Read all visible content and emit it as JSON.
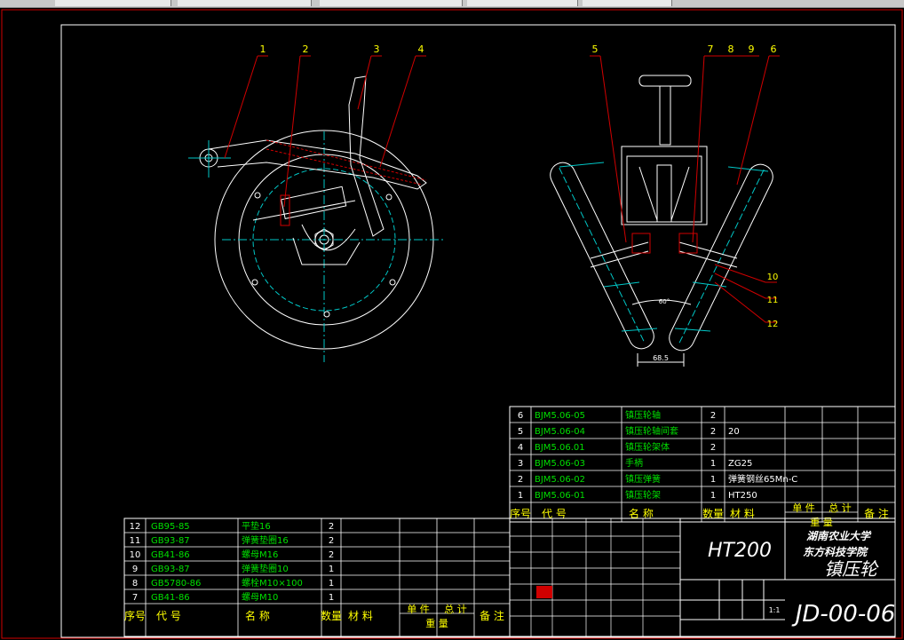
{
  "balloons_left": [
    "1",
    "2",
    "3",
    "4"
  ],
  "balloons_right": [
    "5",
    "7",
    "8",
    "9",
    "6"
  ],
  "side_balloons": [
    "10",
    "11",
    "12"
  ],
  "dims": {
    "spacing": "68.5",
    "angle": "60°"
  },
  "upper_rows": [
    {
      "no": "6",
      "code": "BJM5.06-05",
      "name": "镇压轮轴",
      "qty": "2",
      "mat": ""
    },
    {
      "no": "5",
      "code": "BJM5.06-04",
      "name": "镇压轮轴间套",
      "qty": "2",
      "mat": "20"
    },
    {
      "no": "4",
      "code": "BJM5.06.01",
      "name": "镇压轮架体",
      "qty": "2",
      "mat": ""
    },
    {
      "no": "3",
      "code": "BJM5.06-03",
      "name": "手柄",
      "qty": "1",
      "mat": "ZG25"
    },
    {
      "no": "2",
      "code": "BJM5.06-02",
      "name": "镇压弹簧",
      "qty": "1",
      "mat": "弹簧钢丝65Mn-C"
    },
    {
      "no": "1",
      "code": "BJM5.06-01",
      "name": "镇压轮架",
      "qty": "1",
      "mat": "HT250"
    }
  ],
  "lower_rows": [
    {
      "no": "12",
      "code": "GB95-85",
      "name": "平垫16",
      "qty": "2"
    },
    {
      "no": "11",
      "code": "GB93-87",
      "name": "弹簧垫圈16",
      "qty": "2"
    },
    {
      "no": "10",
      "code": "GB41-86",
      "name": "螺母M16",
      "qty": "2"
    },
    {
      "no": "9",
      "code": "GB93-87",
      "name": "弹簧垫圈10",
      "qty": "1"
    },
    {
      "no": "8",
      "code": "GB5780-86",
      "name": "螺栓M10×100",
      "qty": "1"
    },
    {
      "no": "7",
      "code": "GB41-86",
      "name": "螺母M10",
      "qty": "1"
    }
  ],
  "header": {
    "seq": "序号",
    "code": "代        号",
    "name": "名      称",
    "qty": "数量",
    "mat": "材   料",
    "single": "单 件",
    "total": "总 计",
    "weight": "重    量",
    "note": "备 注"
  },
  "title_block": {
    "material": "HT200",
    "school_1": "湖南农业大学",
    "school_2": "东方科技学院",
    "part_name": "镇压轮",
    "drawing_no": "JD-00-06",
    "scale": "1:1"
  }
}
